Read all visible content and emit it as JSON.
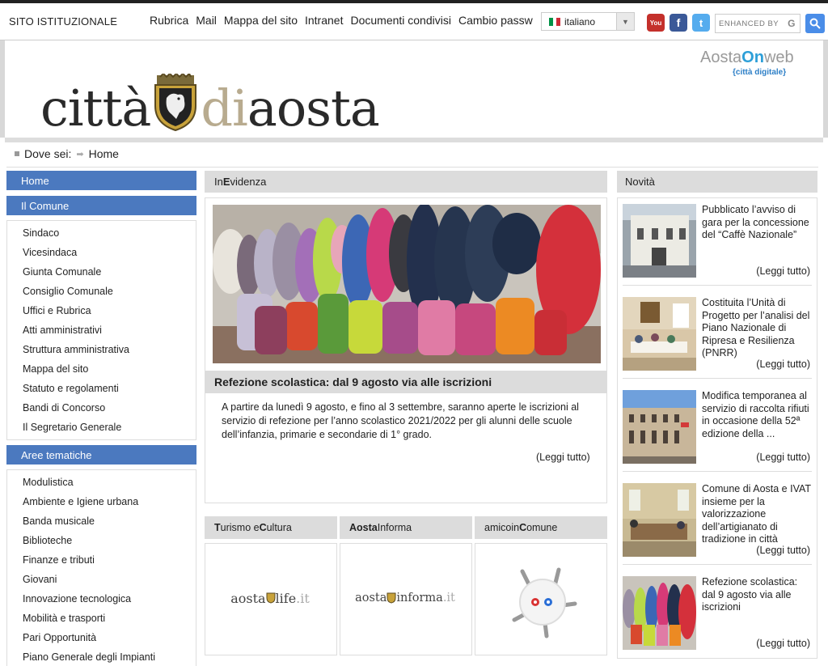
{
  "topbar": {
    "institutional": "SITO ISTITUZIONALE",
    "nav": [
      "Rubrica",
      "Mail",
      "Mappa del sito",
      "Intranet",
      "Documenti condivisi",
      "Cambio passw"
    ],
    "language": "italiano",
    "search_placeholder": "ENHANCED BY",
    "search_brand": "G"
  },
  "header": {
    "logo_part1": "città",
    "logo_part2": "di",
    "logo_part3": "aosta",
    "aostaweb_a": "Aosta",
    "aostaweb_on": "On",
    "aostaweb_b": "web",
    "aostaweb_tag": "{città digitale}"
  },
  "breadcrumb": {
    "label": "Dove sei:",
    "current": "Home"
  },
  "sidebar": {
    "home": "Home",
    "comune_title": "Il Comune",
    "comune_items": [
      "Sindaco",
      "Vicesindaca",
      "Giunta Comunale",
      "Consiglio Comunale",
      "Uffici e Rubrica",
      "Atti amministrativi",
      "Struttura amministrativa",
      "Mappa del sito",
      "Statuto e regolamenti",
      "Bandi di Concorso",
      "Il Segretario Generale"
    ],
    "aree_title": "Aree tematiche",
    "aree_items": [
      "Modulistica",
      "Ambiente e Igiene urbana",
      "Banda musicale",
      "Biblioteche",
      "Finanze e tributi",
      "Giovani",
      "Innovazione tecnologica",
      "Mobilità e trasporti",
      "Pari Opportunità",
      "Piano Generale degli Impianti"
    ]
  },
  "evidenza": {
    "head_a": "In ",
    "head_b": "E",
    "head_c": "videnza",
    "title": "Refezione scolastica: dal 9 agosto via alle iscrizioni",
    "text": "A partire da lunedì 9 agosto, e fino al 3 settembre, saranno aperte le iscrizioni al servizio di refezione per l’anno scolastico 2021/2022 per gli alunni delle scuole dell’infanzia, primarie e secondarie di 1° grado.",
    "more": "(Leggi tutto)"
  },
  "boxes": {
    "b1_a": "T",
    "b1_b": "urismo e ",
    "b1_c": "C",
    "b1_d": "ultura",
    "b2_a": "Aosta",
    "b2_b": "Informa",
    "b3_a": "amicoin",
    "b3_b": "C",
    "b3_c": "omune",
    "logo1_a": "aosta",
    "logo1_b": "life",
    "logo1_c": ".it",
    "logo2_a": "aosta",
    "logo2_b": "informa",
    "logo2_c": ".it"
  },
  "novita": {
    "head": "Novità",
    "items": [
      {
        "title": "Pubblicato l’avviso di gara per la concessione del “Caffè Nazionale”",
        "more": "(Leggi tutto)"
      },
      {
        "title": "Costituita l’Unità di Progetto per l’analisi del Piano Nazionale di Ripresa e Resilienza (PNRR)",
        "more": "(Leggi tutto)"
      },
      {
        "title": "Modifica temporanea al servizio di raccolta rifiuti in occasione della 52ª edizione della ...",
        "more": "(Leggi tutto)"
      },
      {
        "title": "Comune di Aosta e IVAT insieme per la valorizzazione dell’artigianato di tradizione in città",
        "more": "(Leggi tutto)"
      },
      {
        "title": "Refezione scolastica: dal 9 agosto via alle iscrizioni",
        "more": "(Leggi tutto)"
      }
    ]
  },
  "colors": {
    "sidebar_blue": "#4b79bf",
    "panel_grey": "#dcdcdc",
    "logo_gold": "#b8ab8f"
  }
}
